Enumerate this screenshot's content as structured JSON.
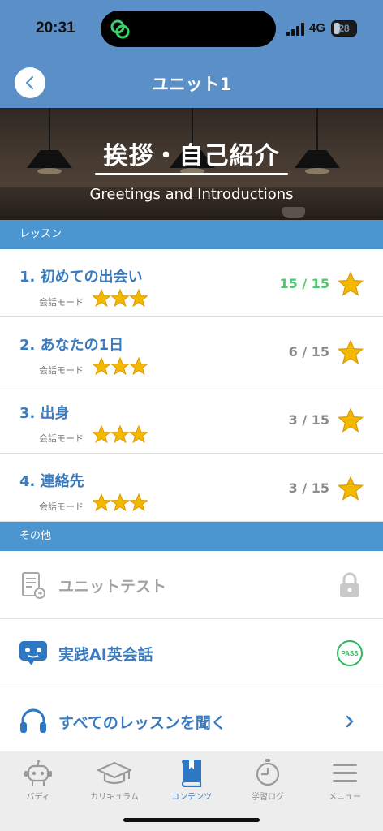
{
  "status_bar": {
    "time": "20:31",
    "network": "4G",
    "battery": "28"
  },
  "nav": {
    "title": "ユニット1",
    "back_icon": "chevron-left-icon"
  },
  "banner": {
    "title": "挨拶・自己紹介",
    "subtitle": "Greetings and Introductions"
  },
  "sections": {
    "lessons": "レッスン",
    "other": "その他"
  },
  "lessons": [
    {
      "title": "1. 初めての出会い",
      "mode": "会話モード",
      "score": "15 / 15",
      "complete": true
    },
    {
      "title": "2. あなたの1日",
      "mode": "会話モード",
      "score": "6 / 15",
      "complete": false
    },
    {
      "title": "3. 出身",
      "mode": "会話モード",
      "score": "3 / 15",
      "complete": false
    },
    {
      "title": "4. 連絡先",
      "mode": "会話モード",
      "score": "3 / 15",
      "complete": false
    }
  ],
  "other_items": [
    {
      "label": "ユニットテスト",
      "icon": "document-test-icon",
      "right_icon": "lock-icon",
      "locked": true
    },
    {
      "label": "実践AI英会話",
      "icon": "ai-chat-icon",
      "badge": "PASS"
    },
    {
      "label": "すべてのレッスンを聞く",
      "icon": "headphones-icon",
      "right_icon": "chevron-right-icon"
    }
  ],
  "tabs": [
    {
      "label": "バディ",
      "icon": "buddy-robot-icon",
      "active": false
    },
    {
      "label": "カリキュラム",
      "icon": "graduation-cap-icon",
      "active": false
    },
    {
      "label": "コンテンツ",
      "icon": "book-icon",
      "active": true
    },
    {
      "label": "学習ログ",
      "icon": "stopwatch-icon",
      "active": false
    },
    {
      "label": "メニュー",
      "icon": "menu-icon",
      "active": false
    }
  ],
  "colors": {
    "header": "#5b8fc7",
    "section": "#4b96d1",
    "accent": "#3a7bbf",
    "complete": "#4cc96b",
    "star": "#f5b800"
  }
}
